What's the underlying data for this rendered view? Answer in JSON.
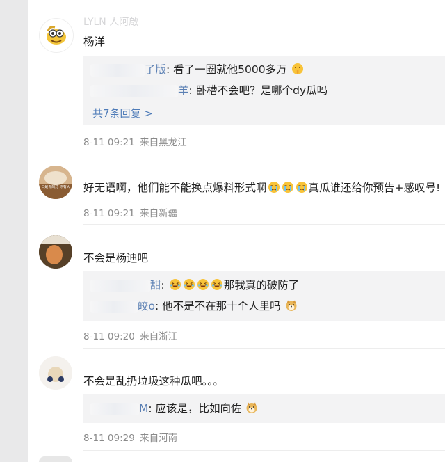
{
  "comments": [
    {
      "top_name_fragment": "LYLN 人阿啟",
      "author_line": "杨洋",
      "replies": [
        {
          "name_suffix": "了版",
          "text": ": 看了一圈就他5000多万"
        },
        {
          "name_suffix": "羊",
          "text": ": 卧槽不会吧？是哪个dy瓜吗"
        }
      ],
      "more_replies": "共7条回复 >",
      "time": "8-11 09:21",
      "location": "来自黑龙江"
    },
    {
      "avatar_text": "日是你的灯 你有大",
      "text": "好无语啊，他们能不能换点爆料形式啊",
      "text_after_emoji": "真瓜谁还给你预告+感叹号!",
      "time": "8-11 09:21",
      "location": "来自新疆"
    },
    {
      "text": "不会是杨迪吧",
      "replies": [
        {
          "name_suffix": "甜",
          "text": ":",
          "after_emoji": "那我真的破防了"
        },
        {
          "name_suffix": "皎o",
          "text": ": 他不是不在那十个人里吗"
        }
      ],
      "time": "8-11 09:20",
      "location": "来自浙江"
    },
    {
      "text": "不会是乱扔垃圾这种瓜吧。。。",
      "replies": [
        {
          "name_suffix": "M",
          "text": ": 应该是，比如向佐"
        }
      ],
      "time": "8-11 09:29",
      "location": "来自河南"
    }
  ],
  "icons": {
    "shush": "shushing-face-emoji",
    "crying": "crying-face-emoji",
    "laughing": "laughing-tears-emoji",
    "doge": "doge-emoji"
  }
}
